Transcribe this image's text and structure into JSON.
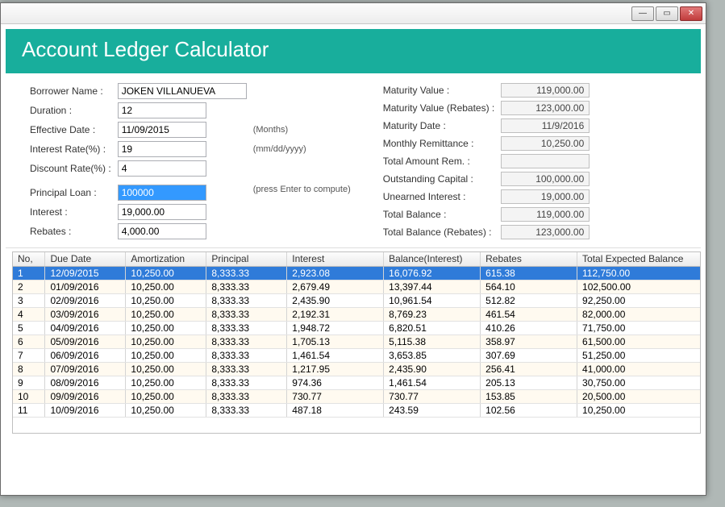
{
  "window": {
    "title": "Account Ledger Calculator"
  },
  "form": {
    "left": {
      "borrower_label": "Borrower Name :",
      "borrower_value": "JOKEN VILLANUEVA",
      "duration_label": "Duration :",
      "duration_value": "12",
      "duration_hint": "(Months)",
      "effdate_label": "Effective Date :",
      "effdate_value": "11/09/2015",
      "effdate_hint": "(mm/dd/yyyy)",
      "irate_label": "Interest Rate(%) :",
      "irate_value": "19",
      "drate_label": "Discount Rate(%) :",
      "drate_value": "4",
      "principal_label": "Principal Loan :",
      "principal_value": "100000",
      "principal_hint": "(press Enter to compute)",
      "interest_label": "Interest :",
      "interest_value": "19,000.00",
      "rebates_label": "Rebates :",
      "rebates_value": "4,000.00"
    },
    "right": {
      "matval_label": "Maturity Value :",
      "matval_value": "119,000.00",
      "matvalreb_label": "Maturity Value (Rebates) :",
      "matvalreb_value": "123,000.00",
      "matdate_label": "Maturity Date :",
      "matdate_value": "11/9/2016",
      "monthrem_label": "Monthly Remittance :",
      "monthrem_value": "10,250.00",
      "totrem_label": "Total Amount Rem. :",
      "totrem_value": "",
      "outcap_label": "Outstanding Capital :",
      "outcap_value": "100,000.00",
      "unearn_label": "Unearned Interest :",
      "unearn_value": "19,000.00",
      "totbal_label": "Total Balance :",
      "totbal_value": "119,000.00",
      "totbalreb_label": "Total Balance (Rebates) :",
      "totbalreb_value": "123,000.00"
    }
  },
  "grid": {
    "headers": {
      "no": "No,",
      "date": "Due Date",
      "amort": "Amortization",
      "prin": "Principal",
      "int": "Interest",
      "bal": "Balance(Interest)",
      "reb": "Rebates",
      "tot": "Total Expected Balance"
    },
    "rows": [
      {
        "no": "1",
        "date": "12/09/2015",
        "amort": "10,250.00",
        "prin": "8,333.33",
        "int": "2,923.08",
        "bal": "16,076.92",
        "reb": "615.38",
        "tot": "112,750.00",
        "selected": true
      },
      {
        "no": "2",
        "date": "01/09/2016",
        "amort": "10,250.00",
        "prin": "8,333.33",
        "int": "2,679.49",
        "bal": "13,397.44",
        "reb": "564.10",
        "tot": "102,500.00"
      },
      {
        "no": "3",
        "date": "02/09/2016",
        "amort": "10,250.00",
        "prin": "8,333.33",
        "int": "2,435.90",
        "bal": "10,961.54",
        "reb": "512.82",
        "tot": "92,250.00"
      },
      {
        "no": "4",
        "date": "03/09/2016",
        "amort": "10,250.00",
        "prin": "8,333.33",
        "int": "2,192.31",
        "bal": "8,769.23",
        "reb": "461.54",
        "tot": "82,000.00"
      },
      {
        "no": "5",
        "date": "04/09/2016",
        "amort": "10,250.00",
        "prin": "8,333.33",
        "int": "1,948.72",
        "bal": "6,820.51",
        "reb": "410.26",
        "tot": "71,750.00"
      },
      {
        "no": "6",
        "date": "05/09/2016",
        "amort": "10,250.00",
        "prin": "8,333.33",
        "int": "1,705.13",
        "bal": "5,115.38",
        "reb": "358.97",
        "tot": "61,500.00"
      },
      {
        "no": "7",
        "date": "06/09/2016",
        "amort": "10,250.00",
        "prin": "8,333.33",
        "int": "1,461.54",
        "bal": "3,653.85",
        "reb": "307.69",
        "tot": "51,250.00"
      },
      {
        "no": "8",
        "date": "07/09/2016",
        "amort": "10,250.00",
        "prin": "8,333.33",
        "int": "1,217.95",
        "bal": "2,435.90",
        "reb": "256.41",
        "tot": "41,000.00"
      },
      {
        "no": "9",
        "date": "08/09/2016",
        "amort": "10,250.00",
        "prin": "8,333.33",
        "int": "974.36",
        "bal": "1,461.54",
        "reb": "205.13",
        "tot": "30,750.00"
      },
      {
        "no": "10",
        "date": "09/09/2016",
        "amort": "10,250.00",
        "prin": "8,333.33",
        "int": "730.77",
        "bal": "730.77",
        "reb": "153.85",
        "tot": "20,500.00"
      },
      {
        "no": "11",
        "date": "10/09/2016",
        "amort": "10,250.00",
        "prin": "8,333.33",
        "int": "487.18",
        "bal": "243.59",
        "reb": "102.56",
        "tot": "10,250.00"
      }
    ]
  }
}
